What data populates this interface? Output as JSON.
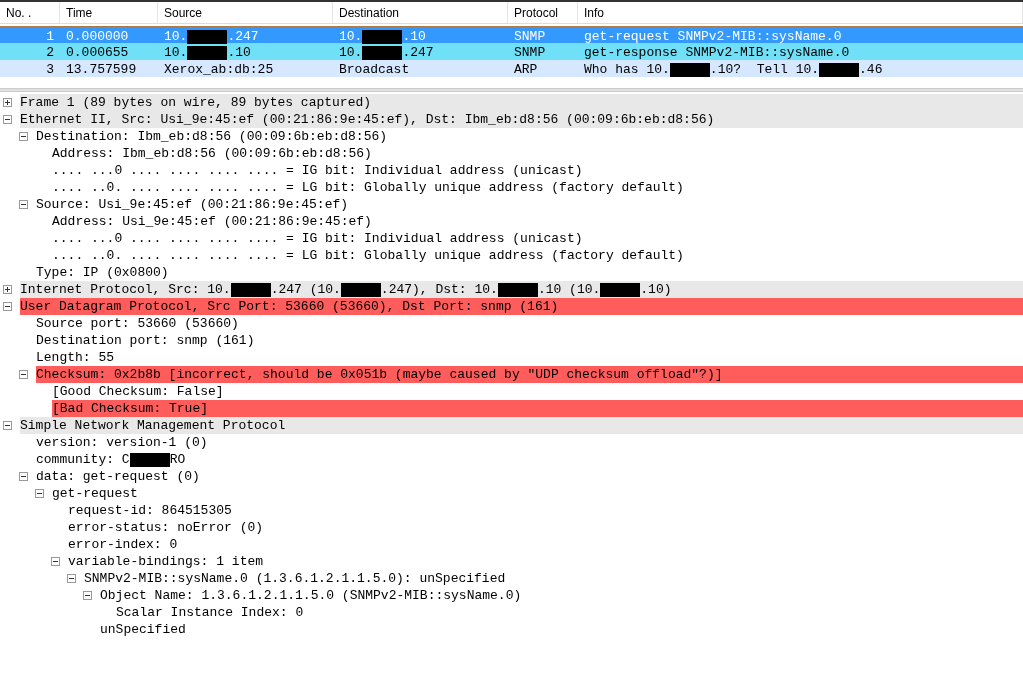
{
  "packet_list": {
    "columns": [
      "No. .",
      "Time",
      "Source",
      "Destination",
      "Protocol",
      "Info"
    ],
    "rows": [
      {
        "selected": true,
        "cells": [
          [
            {
              "kind": "text",
              "text": "1"
            }
          ],
          [
            {
              "kind": "text",
              "text": "0.000000"
            }
          ],
          [
            {
              "kind": "text",
              "text": "10."
            },
            {
              "kind": "redacted"
            },
            {
              "kind": "text",
              "text": ".247"
            }
          ],
          [
            {
              "kind": "text",
              "text": "10."
            },
            {
              "kind": "redacted"
            },
            {
              "kind": "text",
              "text": ".10"
            }
          ],
          [
            {
              "kind": "text",
              "text": "SNMP"
            }
          ],
          [
            {
              "kind": "text",
              "text": "get-request SNMPv2-MIB::sysName.0"
            }
          ]
        ]
      },
      {
        "selected": false,
        "color": "#70e0f8",
        "cells": [
          [
            {
              "kind": "text",
              "text": "2"
            }
          ],
          [
            {
              "kind": "text",
              "text": "0.000655"
            }
          ],
          [
            {
              "kind": "text",
              "text": "10."
            },
            {
              "kind": "redacted"
            },
            {
              "kind": "text",
              "text": ".10"
            }
          ],
          [
            {
              "kind": "text",
              "text": "10."
            },
            {
              "kind": "redacted"
            },
            {
              "kind": "text",
              "text": ".247"
            }
          ],
          [
            {
              "kind": "text",
              "text": "SNMP"
            }
          ],
          [
            {
              "kind": "text",
              "text": "get-response SNMPv2-MIB::sysName.0"
            }
          ]
        ]
      },
      {
        "selected": false,
        "color": "#d6e8ff",
        "cells": [
          [
            {
              "kind": "text",
              "text": "3"
            }
          ],
          [
            {
              "kind": "text",
              "text": "13.757599"
            }
          ],
          [
            {
              "kind": "text",
              "text": "Xerox_ab:db:25"
            }
          ],
          [
            {
              "kind": "text",
              "text": "Broadcast"
            }
          ],
          [
            {
              "kind": "text",
              "text": "ARP"
            }
          ],
          [
            {
              "kind": "text",
              "text": "Who has 10."
            },
            {
              "kind": "redacted"
            },
            {
              "kind": "text",
              "text": ".10?  Tell 10."
            },
            {
              "kind": "redacted"
            },
            {
              "kind": "text",
              "text": ".46"
            }
          ]
        ]
      }
    ]
  },
  "details": [
    {
      "parts": [
        {
          "kind": "text",
          "text": "Frame 1 (89 bytes on wire, 89 bytes captured)"
        }
      ],
      "expanded": false,
      "error": false
    },
    {
      "parts": [
        {
          "kind": "text",
          "text": "Ethernet II, Src: Usi_9e:45:ef (00:21:86:9e:45:ef), Dst: Ibm_eb:d8:56 (00:09:6b:eb:d8:56)"
        }
      ],
      "expanded": true,
      "error": false,
      "children": [
        {
          "parts": [
            {
              "kind": "text",
              "text": "Destination: Ibm_eb:d8:56 (00:09:6b:eb:d8:56)"
            }
          ],
          "expanded": true,
          "error": false,
          "children": [
            {
              "parts": [
                {
                  "kind": "text",
                  "text": "Address: Ibm_eb:d8:56 (00:09:6b:eb:d8:56)"
                }
              ],
              "error": false
            },
            {
              "parts": [
                {
                  "kind": "text",
                  "text": ".... ...0 .... .... .... .... = IG bit: Individual address (unicast)"
                }
              ],
              "error": false
            },
            {
              "parts": [
                {
                  "kind": "text",
                  "text": ".... ..0. .... .... .... .... = LG bit: Globally unique address (factory default)"
                }
              ],
              "error": false
            }
          ]
        },
        {
          "parts": [
            {
              "kind": "text",
              "text": "Source: Usi_9e:45:ef (00:21:86:9e:45:ef)"
            }
          ],
          "expanded": true,
          "error": false,
          "children": [
            {
              "parts": [
                {
                  "kind": "text",
                  "text": "Address: Usi_9e:45:ef (00:21:86:9e:45:ef)"
                }
              ],
              "error": false
            },
            {
              "parts": [
                {
                  "kind": "text",
                  "text": ".... ...0 .... .... .... .... = IG bit: Individual address (unicast)"
                }
              ],
              "error": false
            },
            {
              "parts": [
                {
                  "kind": "text",
                  "text": ".... ..0. .... .... .... .... = LG bit: Globally unique address (factory default)"
                }
              ],
              "error": false
            }
          ]
        },
        {
          "parts": [
            {
              "kind": "text",
              "text": "Type: IP (0x0800)"
            }
          ],
          "error": false
        }
      ]
    },
    {
      "parts": [
        {
          "kind": "text",
          "text": "Internet Protocol, Src: 10."
        },
        {
          "kind": "redacted"
        },
        {
          "kind": "text",
          "text": ".247 (10."
        },
        {
          "kind": "redacted"
        },
        {
          "kind": "text",
          "text": ".247), Dst: 10."
        },
        {
          "kind": "redacted"
        },
        {
          "kind": "text",
          "text": ".10 (10."
        },
        {
          "kind": "redacted"
        },
        {
          "kind": "text",
          "text": ".10)"
        }
      ],
      "expanded": false,
      "error": false
    },
    {
      "parts": [
        {
          "kind": "text",
          "text": "User Datagram Protocol, Src Port: 53660 (53660), Dst Port: snmp (161)"
        }
      ],
      "expanded": true,
      "error": true,
      "children": [
        {
          "parts": [
            {
              "kind": "text",
              "text": "Source port: 53660 (53660)"
            }
          ],
          "error": false
        },
        {
          "parts": [
            {
              "kind": "text",
              "text": "Destination port: snmp (161)"
            }
          ],
          "error": false
        },
        {
          "parts": [
            {
              "kind": "text",
              "text": "Length: 55"
            }
          ],
          "error": false
        },
        {
          "parts": [
            {
              "kind": "text",
              "text": "Checksum: 0x2b8b [incorrect, should be 0x051b (maybe caused by \"UDP checksum offload\"?)]"
            }
          ],
          "expanded": true,
          "error": true,
          "children": [
            {
              "parts": [
                {
                  "kind": "text",
                  "text": "[Good Checksum: False]"
                }
              ],
              "error": false
            },
            {
              "parts": [
                {
                  "kind": "text",
                  "text": "[Bad Checksum: True]"
                }
              ],
              "error": true
            }
          ]
        }
      ]
    },
    {
      "parts": [
        {
          "kind": "text",
          "text": "Simple Network Management Protocol"
        }
      ],
      "expanded": true,
      "error": false,
      "children": [
        {
          "parts": [
            {
              "kind": "text",
              "text": "version: version-1 (0)"
            }
          ],
          "error": false
        },
        {
          "parts": [
            {
              "kind": "text",
              "text": "community: C"
            },
            {
              "kind": "redacted"
            },
            {
              "kind": "text",
              "text": "RO"
            }
          ],
          "error": false
        },
        {
          "parts": [
            {
              "kind": "text",
              "text": "data: get-request (0)"
            }
          ],
          "expanded": true,
          "error": false,
          "children": [
            {
              "parts": [
                {
                  "kind": "text",
                  "text": "get-request"
                }
              ],
              "expanded": true,
              "error": false,
              "children": [
                {
                  "parts": [
                    {
                      "kind": "text",
                      "text": "request-id: 864515305"
                    }
                  ],
                  "error": false
                },
                {
                  "parts": [
                    {
                      "kind": "text",
                      "text": "error-status: noError (0)"
                    }
                  ],
                  "error": false
                },
                {
                  "parts": [
                    {
                      "kind": "text",
                      "text": "error-index: 0"
                    }
                  ],
                  "error": false
                },
                {
                  "parts": [
                    {
                      "kind": "text",
                      "text": "variable-bindings: 1 item"
                    }
                  ],
                  "expanded": true,
                  "error": false,
                  "children": [
                    {
                      "parts": [
                        {
                          "kind": "text",
                          "text": "SNMPv2-MIB::sysName.0 (1.3.6.1.2.1.1.5.0): unSpecified"
                        }
                      ],
                      "expanded": true,
                      "error": false,
                      "children": [
                        {
                          "parts": [
                            {
                              "kind": "text",
                              "text": "Object Name: 1.3.6.1.2.1.1.5.0 (SNMPv2-MIB::sysName.0)"
                            }
                          ],
                          "expanded": true,
                          "error": false,
                          "children": [
                            {
                              "parts": [
                                {
                                  "kind": "text",
                                  "text": "Scalar Instance Index: 0"
                                }
                              ],
                              "error": false
                            }
                          ]
                        },
                        {
                          "parts": [
                            {
                              "kind": "text",
                              "text": "unSpecified"
                            }
                          ],
                          "error": false
                        }
                      ]
                    }
                  ]
                }
              ]
            }
          ]
        }
      ]
    }
  ]
}
